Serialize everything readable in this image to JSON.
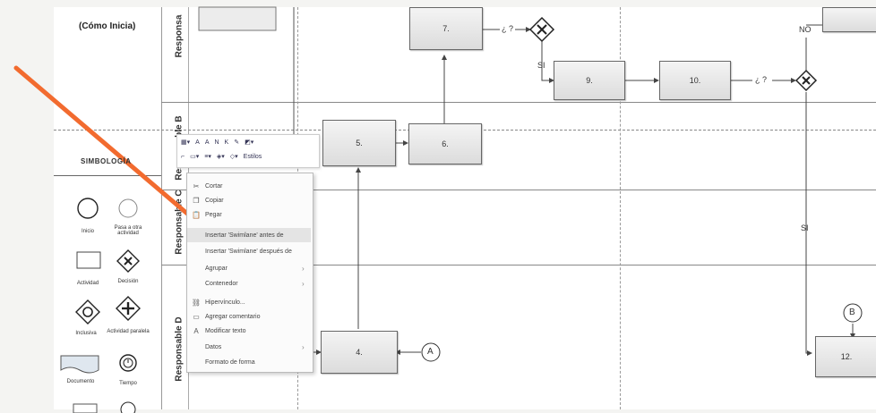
{
  "header_text": "(Cómo Inicia)",
  "lanes": [
    {
      "name": "Responsable A",
      "visible_label": "Responsa"
    },
    {
      "name": "Responsable B",
      "visible_label": "Responsable B"
    },
    {
      "name": "Responsable C",
      "visible_label": "Responsable C"
    },
    {
      "name": "Responsable D",
      "visible_label": "Responsable D"
    }
  ],
  "shapes": {
    "s4": "4.",
    "s5": "5.",
    "s6": "6.",
    "s7": "7.",
    "s9": "9.",
    "s10": "10.",
    "s12": "12."
  },
  "labels": {
    "q1": "¿ ?",
    "q2": "¿ ?",
    "si1": "SI",
    "si2": "SI",
    "no": "NO"
  },
  "connectors": {
    "a": "A",
    "b": "B"
  },
  "toolbar": {
    "styles_label": "Estilos"
  },
  "context_menu": {
    "items": [
      {
        "label": "Cortar",
        "icon": "cut-icon",
        "submenu": false
      },
      {
        "label": "Copiar",
        "icon": "copy-icon",
        "submenu": false
      },
      {
        "label": "Pegar",
        "icon": "paste-icon",
        "submenu": false
      },
      {
        "label": "Insertar 'Swimlane' antes de",
        "icon": "",
        "submenu": false,
        "highlighted": true
      },
      {
        "label": "Insertar 'Swimlane' después de",
        "icon": "",
        "submenu": false
      },
      {
        "label": "Agrupar",
        "icon": "",
        "submenu": true
      },
      {
        "label": "Contenedor",
        "icon": "",
        "submenu": true
      },
      {
        "label": "Hipervínculo...",
        "icon": "link-icon",
        "submenu": false
      },
      {
        "label": "Agregar comentario",
        "icon": "comment-icon",
        "submenu": false
      },
      {
        "label": "Modificar texto",
        "icon": "text-icon",
        "submenu": false
      },
      {
        "label": "Datos",
        "icon": "",
        "submenu": true
      },
      {
        "label": "Formato de forma",
        "icon": "",
        "submenu": false
      }
    ]
  },
  "symbology": {
    "title": "SIMBOLOGÍA",
    "items": [
      {
        "label": "Inicio",
        "icon": "start-circle-icon"
      },
      {
        "label": "Pasa a otra actividad",
        "icon": "connector-circle-icon"
      },
      {
        "label": "Actividad",
        "icon": "activity-rect-icon"
      },
      {
        "label": "Decisión",
        "icon": "exclusive-gateway-icon"
      },
      {
        "label": "Inclusiva",
        "icon": "inclusive-gateway-icon"
      },
      {
        "label": "Actividad paralela",
        "icon": "parallel-gateway-icon"
      },
      {
        "label": "Documento",
        "icon": "document-icon"
      },
      {
        "label": "Tiempo",
        "icon": "timer-icon"
      }
    ]
  },
  "colors": {
    "arrow": "#f26b2f",
    "line": "#444444",
    "lane_border": "#888888"
  }
}
